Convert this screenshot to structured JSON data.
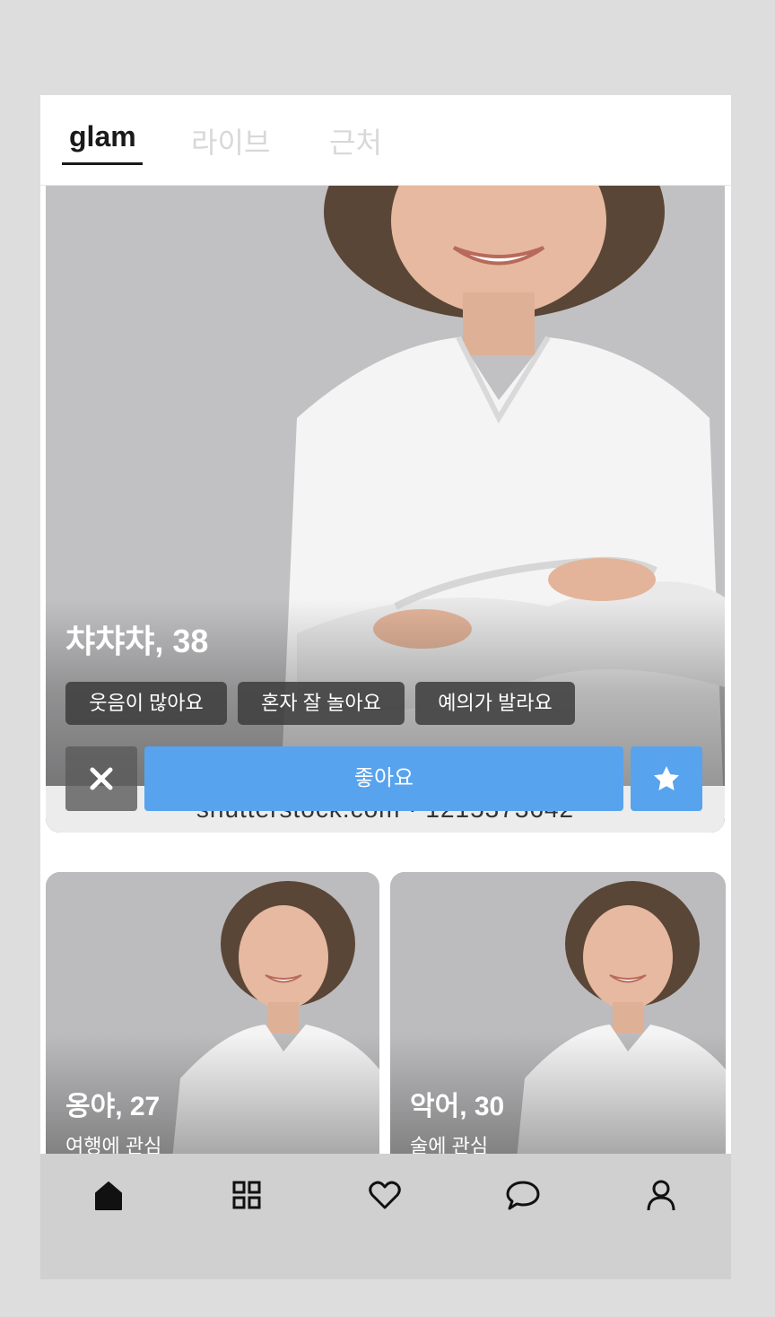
{
  "header": {
    "tabs": [
      {
        "label": "glam",
        "active": true
      },
      {
        "label": "라이브",
        "active": false
      },
      {
        "label": "근처",
        "active": false
      }
    ]
  },
  "main_card": {
    "name_age": "챠챠챠, 38",
    "tags": [
      "웃음이 많아요",
      "혼자 잘 놀아요",
      "예의가 발라요"
    ],
    "watermark": "shutterstock.com · 1215373642",
    "like_label": "좋아요",
    "dismiss_icon": "close-icon",
    "star_icon": "star-icon"
  },
  "cards": [
    {
      "name_age": "옹야, 27",
      "interest": "여행에 관심"
    },
    {
      "name_age": "악어, 30",
      "interest": "술에 관심"
    }
  ],
  "bottom_nav": {
    "items": [
      "home-icon",
      "grid-icon",
      "heart-icon",
      "chat-icon",
      "profile-icon"
    ]
  },
  "colors": {
    "accent": "#58a3ee",
    "background": "#dddddd",
    "nav_bg": "#d0d0d0",
    "inactive_tab": "#d8d8d8"
  }
}
